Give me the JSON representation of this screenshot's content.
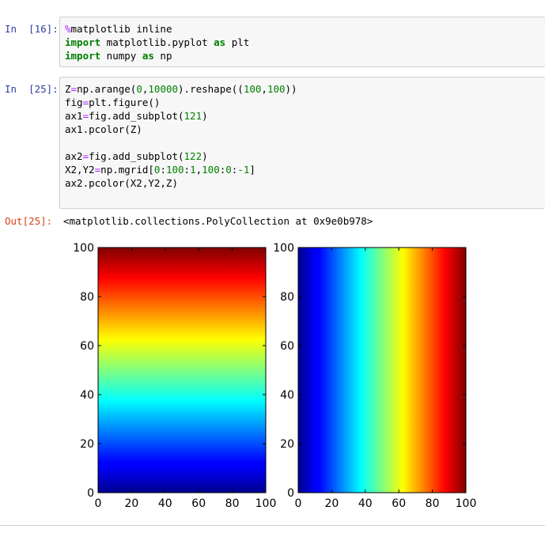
{
  "cells": [
    {
      "prompt": "In  [16]:",
      "lines": [
        [
          {
            "t": "%",
            "c": "mg"
          },
          {
            "t": "matplotlib inline",
            "c": ""
          }
        ],
        [
          {
            "t": "import",
            "c": "kw"
          },
          {
            "t": " matplotlib.pyplot ",
            "c": ""
          },
          {
            "t": "as",
            "c": "kw"
          },
          {
            "t": " plt",
            "c": ""
          }
        ],
        [
          {
            "t": "import",
            "c": "kw"
          },
          {
            "t": " numpy ",
            "c": ""
          },
          {
            "t": "as",
            "c": "kw"
          },
          {
            "t": " np",
            "c": ""
          }
        ]
      ]
    },
    {
      "prompt": "In  [25]:",
      "lines": [
        [
          {
            "t": "Z",
            "c": ""
          },
          {
            "t": "=",
            "c": "op"
          },
          {
            "t": "np.arange(",
            "c": ""
          },
          {
            "t": "0",
            "c": "num"
          },
          {
            "t": ",",
            "c": ""
          },
          {
            "t": "10000",
            "c": "num"
          },
          {
            "t": ").reshape((",
            "c": ""
          },
          {
            "t": "100",
            "c": "num"
          },
          {
            "t": ",",
            "c": ""
          },
          {
            "t": "100",
            "c": "num"
          },
          {
            "t": "))",
            "c": ""
          }
        ],
        [
          {
            "t": "fig",
            "c": ""
          },
          {
            "t": "=",
            "c": "op"
          },
          {
            "t": "plt.figure()",
            "c": ""
          }
        ],
        [
          {
            "t": "ax1",
            "c": ""
          },
          {
            "t": "=",
            "c": "op"
          },
          {
            "t": "fig.add_subplot(",
            "c": ""
          },
          {
            "t": "121",
            "c": "num"
          },
          {
            "t": ")",
            "c": ""
          }
        ],
        [
          {
            "t": "ax1.pcolor(Z)",
            "c": ""
          }
        ],
        [],
        [
          {
            "t": "ax2",
            "c": ""
          },
          {
            "t": "=",
            "c": "op"
          },
          {
            "t": "fig.add_subplot(",
            "c": ""
          },
          {
            "t": "122",
            "c": "num"
          },
          {
            "t": ")",
            "c": ""
          }
        ],
        [
          {
            "t": "X2,Y2",
            "c": ""
          },
          {
            "t": "=",
            "c": "op"
          },
          {
            "t": "np.mgrid[",
            "c": ""
          },
          {
            "t": "0",
            "c": "num"
          },
          {
            "t": ":",
            "c": ""
          },
          {
            "t": "100",
            "c": "num"
          },
          {
            "t": ":",
            "c": ""
          },
          {
            "t": "1",
            "c": "num"
          },
          {
            "t": ",",
            "c": ""
          },
          {
            "t": "100",
            "c": "num"
          },
          {
            "t": ":",
            "c": ""
          },
          {
            "t": "0",
            "c": "num"
          },
          {
            "t": ":",
            "c": ""
          },
          {
            "t": "-1",
            "c": "num"
          },
          {
            "t": "]",
            "c": ""
          }
        ],
        [
          {
            "t": "ax2.pcolor(X2,Y2,Z)",
            "c": ""
          }
        ]
      ]
    }
  ],
  "output": {
    "prompt": "Out[25]:",
    "text": "<matplotlib.collections.PolyCollection at 0x9e0b978>"
  },
  "chart_data": [
    {
      "type": "heatmap",
      "colormap": "jet",
      "gradient_direction": "vertical",
      "xlim": [
        0,
        100
      ],
      "ylim": [
        0,
        100
      ],
      "xticks": [
        "0",
        "20",
        "40",
        "60",
        "80",
        "100"
      ],
      "yticks": [
        "0",
        "20",
        "40",
        "60",
        "80",
        "100"
      ],
      "value_range": [
        0,
        9999
      ]
    },
    {
      "type": "heatmap",
      "colormap": "jet",
      "gradient_direction": "horizontal",
      "xlim": [
        0,
        100
      ],
      "ylim": [
        0,
        100
      ],
      "xticks": [
        "0",
        "20",
        "40",
        "60",
        "80",
        "100"
      ],
      "yticks": [
        "0",
        "20",
        "40",
        "60",
        "80",
        "100"
      ],
      "value_range": [
        0,
        9999
      ]
    }
  ]
}
